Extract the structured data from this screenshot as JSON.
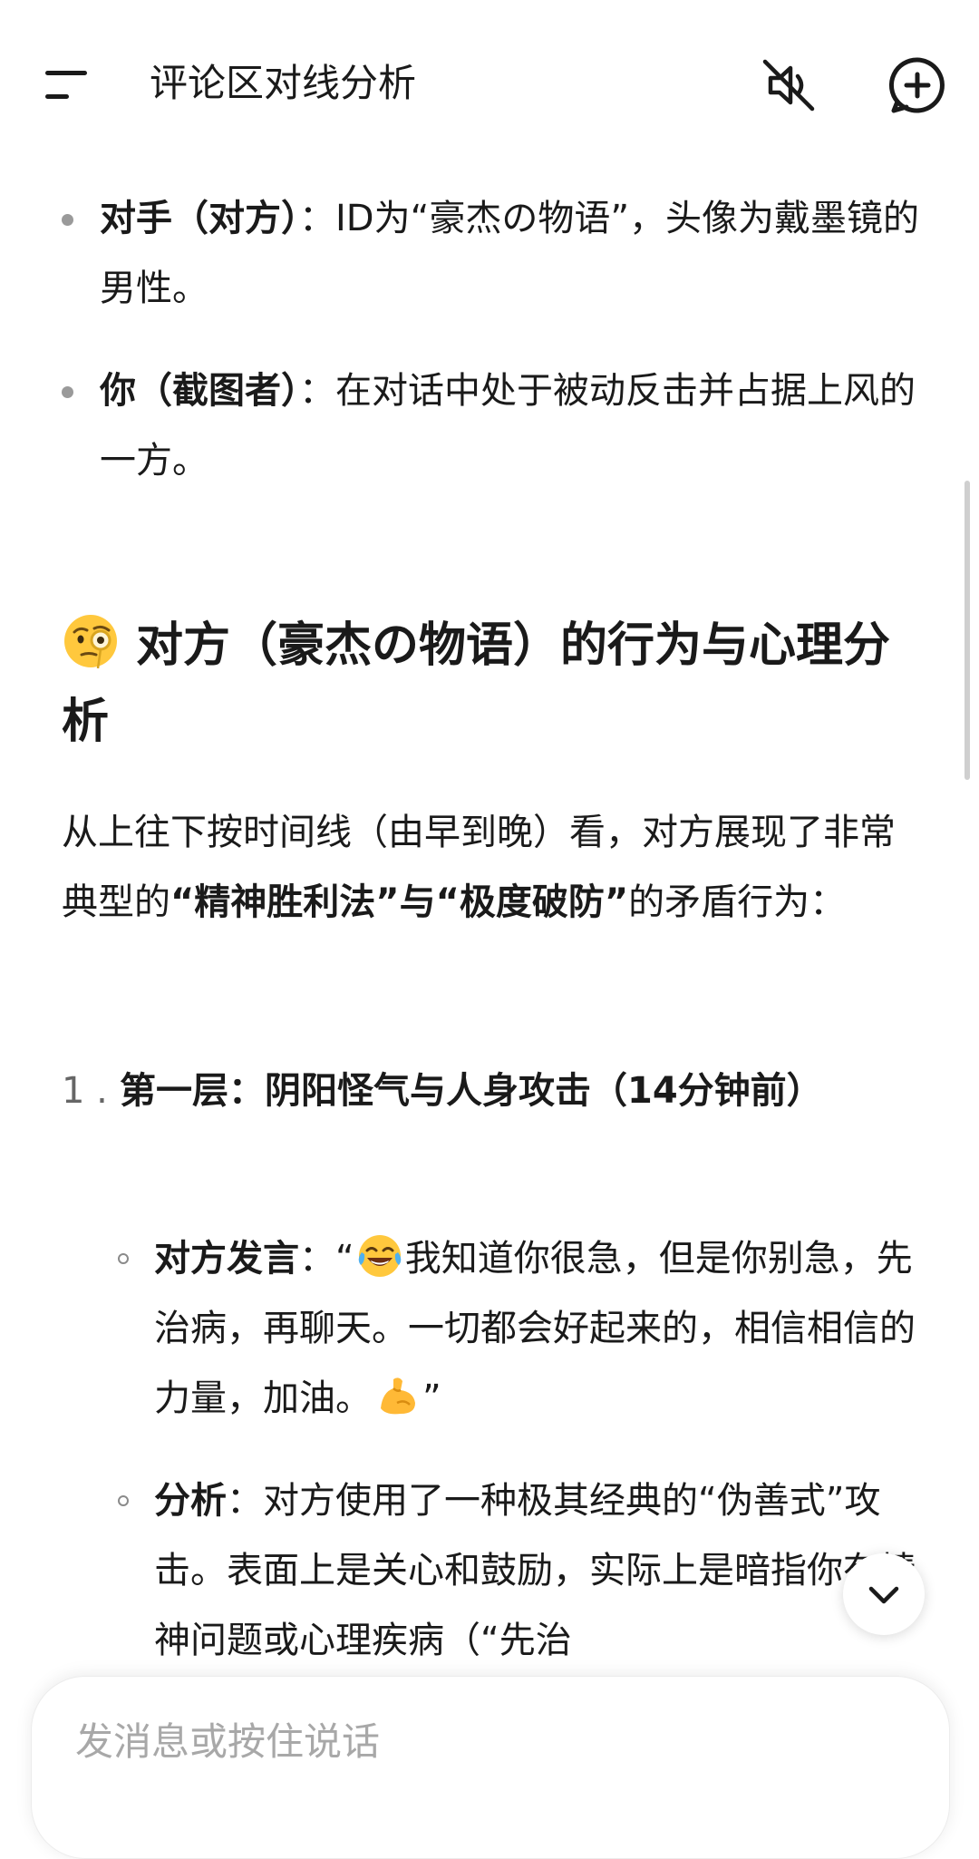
{
  "header": {
    "title": "评论区对线分析",
    "menu_icon": "menu-icon",
    "mute_icon": "speaker-mute-icon",
    "new_chat_icon": "new-chat-icon"
  },
  "content": {
    "bullets": [
      {
        "bold": "对手（对方）",
        "text": "：ID为“豪杰の物语”，头像为戴墨镜的男性。"
      },
      {
        "bold": "你（截图者）",
        "text": "：在对话中处于被动反击并占据上风的一方。"
      }
    ],
    "heading": {
      "icon": "monocle-face-emoji",
      "text": "对方（豪杰の物语）的行为与心理分析"
    },
    "intro": {
      "before": "从上往下按时间线（由早到晚）看，对方展现了非常典型的",
      "bold": "“精神胜利法”与“极度破防”",
      "after": "的矛盾行为："
    },
    "numbered": [
      {
        "num": "1 .",
        "title": "第一层：阴阳怪气与人身攻击（14分钟前）",
        "sub": [
          {
            "bold": "对方发言",
            "pre": "：“",
            "emoji1": "tears-of-joy-emoji",
            "mid": "我知道你很急，但是你别急，先治病，再聊天。一切都会好起来的，相信相信的力量，加油。",
            "emoji2": "flexed-biceps-emoji",
            "post": "”"
          },
          {
            "bold": "分析",
            "text": "：对方使用了一种极其经典的“伪善式”攻击。表面上是关心和鼓励，实际上是暗指你有精神问题或心理疾病（“先治"
          }
        ]
      }
    ]
  },
  "input": {
    "placeholder": "发消息或按住说话"
  },
  "scroll_down_icon": "chevron-down-icon"
}
